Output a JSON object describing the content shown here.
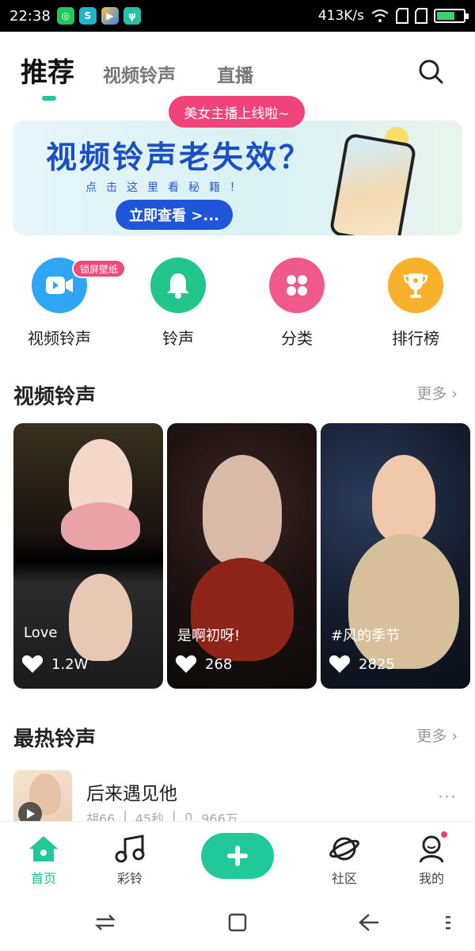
{
  "status_bar": {
    "time": "22:38",
    "speed": "413K/s",
    "battery_level": 0.7,
    "app_icons": [
      "app-icon-1",
      "app-icon-2",
      "app-icon-3",
      "usb-icon"
    ]
  },
  "top_tabs": {
    "active": "推荐",
    "items": [
      "视频铃声",
      "直播"
    ]
  },
  "live_tip": "美女主播上线啦~",
  "banner": {
    "title": "视频铃声老失效？",
    "subtitle": "点击这里看秘籍！",
    "button": "立即查看 >..."
  },
  "quick_entries": [
    {
      "label": "视频铃声",
      "badge": "锁屏壁纸",
      "color": "#2ea6f3"
    },
    {
      "label": "铃声",
      "color": "#22c58a"
    },
    {
      "label": "分类",
      "color": "#f05a8b"
    },
    {
      "label": "排行榜",
      "color": "#f7b12a"
    }
  ],
  "video_section": {
    "title": "视频铃声",
    "more": "更多 ›",
    "cards": [
      {
        "label": "Love",
        "likes": "1.2W"
      },
      {
        "label": "是啊初呀!",
        "likes": "268"
      },
      {
        "label": "#风的季节",
        "likes": "2825"
      }
    ]
  },
  "hot_section": {
    "title": "最热铃声",
    "more": "更多 ›",
    "songs": [
      {
        "title": "后来遇见他",
        "artist": "胡66",
        "duration": "45秒",
        "plays": "966万"
      }
    ]
  },
  "bottom_nav": [
    {
      "label": "首页",
      "icon": "home-icon",
      "active": true
    },
    {
      "label": "彩铃",
      "icon": "music-note-icon"
    },
    {
      "label": "",
      "icon": "plus-icon"
    },
    {
      "label": "社区",
      "icon": "planet-icon"
    },
    {
      "label": "我的",
      "icon": "user-icon"
    }
  ],
  "colors": {
    "accent": "#21c99a",
    "live_tip": "#f0437a",
    "banner_blue": "#1f55d8"
  }
}
